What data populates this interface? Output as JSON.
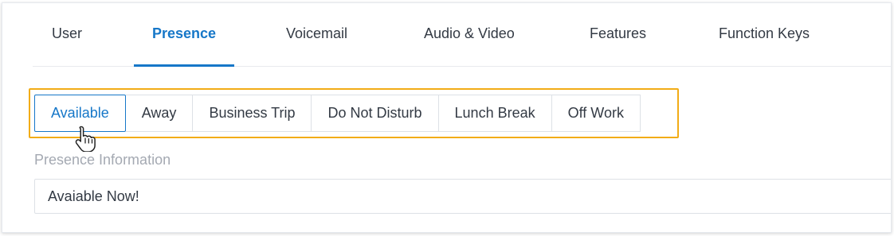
{
  "tabs": [
    {
      "label": "User",
      "active": false
    },
    {
      "label": "Presence",
      "active": true
    },
    {
      "label": "Voicemail",
      "active": false
    },
    {
      "label": "Audio & Video",
      "active": false
    },
    {
      "label": "Features",
      "active": false
    },
    {
      "label": "Function Keys",
      "active": false
    }
  ],
  "presence_statuses": [
    {
      "label": "Available",
      "selected": true
    },
    {
      "label": "Away",
      "selected": false
    },
    {
      "label": "Business Trip",
      "selected": false
    },
    {
      "label": "Do Not Disturb",
      "selected": false
    },
    {
      "label": "Lunch Break",
      "selected": false
    },
    {
      "label": "Off Work",
      "selected": false
    }
  ],
  "presence_info": {
    "label": "Presence Information",
    "value": "Avaiable Now!"
  },
  "icons": {
    "cursor": "hand-pointer-icon"
  },
  "colors": {
    "accent": "#1677c8",
    "highlight": "#f2ac16",
    "text": "#333a44",
    "muted_label": "#a4a9b2",
    "border": "#dde1e6"
  }
}
